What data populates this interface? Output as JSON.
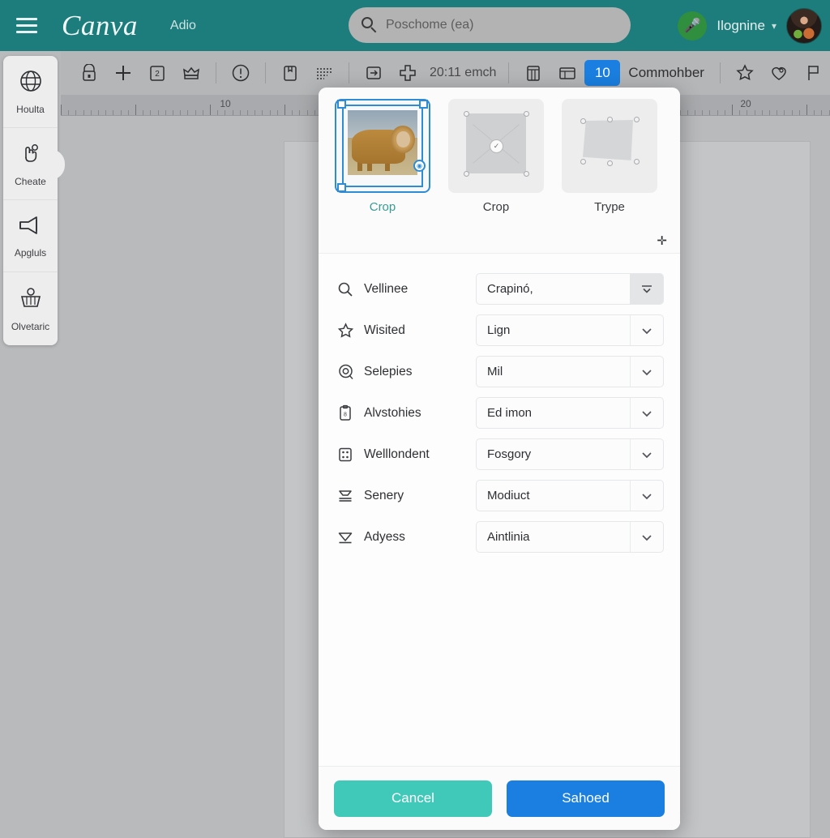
{
  "header": {
    "menu_icon": "hamburger-icon",
    "brand": "Canva",
    "app_label": "Adio",
    "search": {
      "icon": "search-icon",
      "placeholder": "Poschome (ea)"
    },
    "status_badge_icon": "microphone-icon",
    "user_name": "Ilognine",
    "user_chevron": "chevron-down-icon",
    "avatar": "user-avatar"
  },
  "toolbar": {
    "icons": [
      "lock-icon",
      "plus-icon",
      "numbered-page-icon",
      "crown-icon",
      "alert-circle-icon",
      "bookmark-page-icon",
      "list-lines-icon",
      "swap-box-icon",
      "cross-add-icon"
    ],
    "measure_text": "20:11 emch",
    "view_icons": [
      "table-grid-icon",
      "table-rows-icon"
    ],
    "count_badge": "10",
    "section_label": "Commohber",
    "right_icons": [
      "star-icon",
      "heart-stamp-icon",
      "flag-icon"
    ]
  },
  "ruler": {
    "labels": [
      "10",
      "20"
    ]
  },
  "sidebar": {
    "items": [
      {
        "label": "Houlta",
        "icon": "globe-icon",
        "active": false
      },
      {
        "label": "Cheate",
        "icon": "hand-pointer-icon",
        "active": true
      },
      {
        "label": "Apgluls",
        "icon": "megaphone-icon",
        "active": false
      },
      {
        "label": "Olvetaric",
        "icon": "basket-icon",
        "active": false
      }
    ]
  },
  "canvas": {
    "image_alt": "lion-photo",
    "selection": "red-dashed-selection"
  },
  "modal": {
    "thumbnails": [
      {
        "caption": "Crop",
        "selected": true,
        "kind": "photo"
      },
      {
        "caption": "Crop",
        "selected": false,
        "kind": "placeholder-nodes"
      },
      {
        "caption": "Trype",
        "selected": false,
        "kind": "placeholder-skew"
      }
    ],
    "cursor_glyph": "✛",
    "rows": [
      {
        "icon": "search-icon",
        "label": "Vellinee",
        "value": "Crapinó,",
        "dropdown_style": "filled"
      },
      {
        "icon": "star-icon",
        "label": "Wisited",
        "value": "Lign",
        "dropdown_style": "plain"
      },
      {
        "icon": "target-icon",
        "label": "Selepies",
        "value": "Mil",
        "dropdown_style": "plain"
      },
      {
        "icon": "clipboard-icon",
        "label": "Alvstohies",
        "value": "Ed imon",
        "dropdown_style": "plain"
      },
      {
        "icon": "grid-dots-icon",
        "label": "Welllondent",
        "value": "Fosgory",
        "dropdown_style": "plain"
      },
      {
        "icon": "layers-icon",
        "label": "Senery",
        "value": "Modiuct",
        "dropdown_style": "plain"
      },
      {
        "icon": "funnel-icon",
        "label": "Adyess",
        "value": "Aintlinia",
        "dropdown_style": "plain"
      }
    ],
    "buttons": {
      "cancel": "Cancel",
      "save": "Sahoed"
    }
  },
  "colors": {
    "header_teal": "#1d7c7c",
    "accent_blue": "#1a7fe0",
    "cancel_teal": "#40c9b8",
    "selection_red": "#d81515",
    "selection_blue": "#2e8bd6"
  }
}
